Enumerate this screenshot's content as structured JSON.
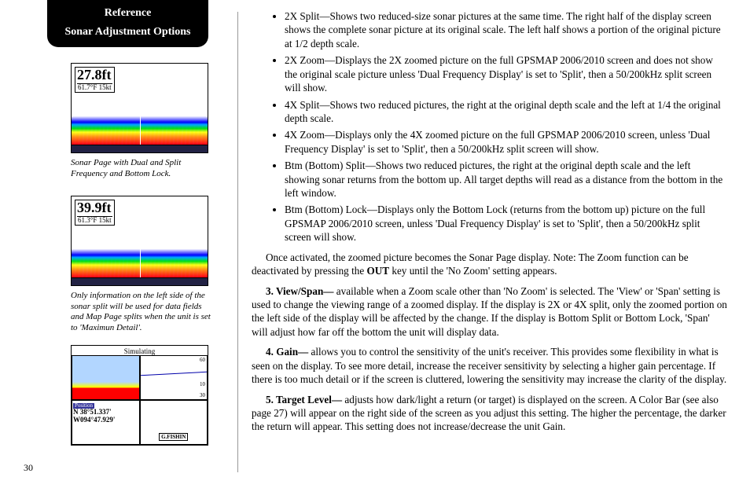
{
  "header": {
    "title1": "Reference",
    "title2": "Sonar Adjustment Options"
  },
  "fig1": {
    "depth": "27.8ft",
    "temp_speed": "61.7°F 15kt",
    "caption": "Sonar Page with Dual and Split Frequency and Bottom Lock."
  },
  "fig2": {
    "depth": "39.9ft",
    "temp_speed": "61.3°F 15kt",
    "caption": "Only information on the left side of the sonar split will be used for data fields and Map Page splits when the unit is set to 'Maximun Detail'."
  },
  "fig3": {
    "sim": "Simulating",
    "position_label": "Position",
    "lat": "N  38°51.337'",
    "lon": "W094°47.929'",
    "gfish": "G.FISHIN"
  },
  "page_number": "30",
  "bullets": [
    "2X Split—Shows two reduced-size sonar pictures at the same time. The right half of the display screen shows the complete sonar picture at its original scale. The left half shows a portion of the original picture at 1/2 depth scale.",
    "2X Zoom—Displays the 2X zoomed picture on the full GPSMAP 2006/2010 screen and does not show the original scale picture unless 'Dual Frequency Display' is set to 'Split', then a 50/200kHz split screen will show.",
    "4X Split—Shows two reduced pictures, the right at the original depth scale and the left at 1/4 the original depth scale.",
    "4X Zoom—Displays only the 4X zoomed picture on the full GPSMAP 2006/2010 screen, unless 'Dual Frequency Display' is set to 'Split', then a 50/200kHz split screen will show.",
    "Btm (Bottom) Split—Shows two reduced pictures, the right at the original depth scale and the left showing sonar returns from the bottom up. All target depths will read as a distance from the bottom in the left window.",
    "Btm (Bottom) Lock—Displays only the Bottom Lock (returns from the bottom up) picture on the full GPSMAP 2006/2010 screen, unless 'Dual Frequency Display' is set to 'Split', then a 50/200kHz split screen will show."
  ],
  "para_activated_pre": "Once activated, the zoomed picture becomes the Sonar Page display. Note: The Zoom function can be deactivated by pressing the ",
  "para_activated_key": "OUT",
  "para_activated_post": " key until the 'No Zoom' setting appears.",
  "item3_label": "3. View/Span—",
  "item3_text": " available when a Zoom scale other than 'No Zoom' is selected. The 'View' or 'Span' setting is used to change the viewing range of a zoomed display. If the display is 2X or 4X split, only the zoomed portion on the left side of the display will be affected by the change. If the display is Bottom Split or Bottom Lock, 'Span' will adjust how far off the bottom the unit will display data.",
  "item4_label": "4. Gain—",
  "item4_text": " allows you to control the sensitivity of the unit's receiver. This provides some flexibility in what is seen on the display. To see more detail, increase the receiver sensitivity by selecting a higher gain percentage. If there is too much detail or if the screen is cluttered, lowering the sensitivity may increase the clarity of the display.",
  "item5_label": "5. Target Level—",
  "item5_text": " adjusts how dark/light a return (or target) is displayed on the screen. A Color Bar (see also page 27) will appear on the right side of the screen as you adjust this setting. The higher the percentage, the darker the return will appear. This setting does not increase/decrease the unit Gain."
}
